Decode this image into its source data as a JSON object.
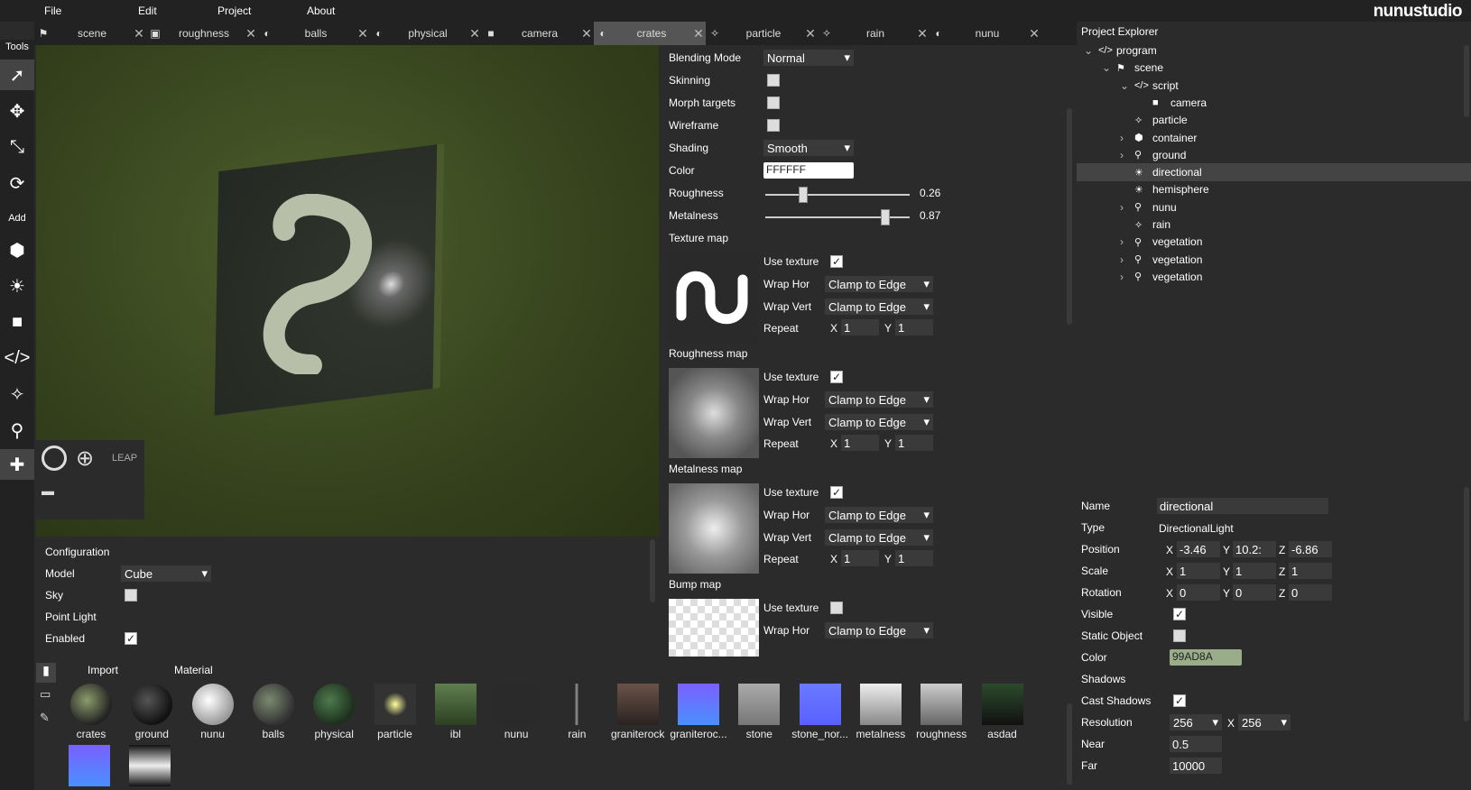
{
  "menu": {
    "file": "File",
    "edit": "Edit",
    "project": "Project",
    "about": "About"
  },
  "logo": "nunustudio",
  "tabs": [
    {
      "label": "scene",
      "icon": "scene-icon"
    },
    {
      "label": "roughness",
      "icon": "image-icon"
    },
    {
      "label": "balls",
      "icon": "material-icon"
    },
    {
      "label": "physical",
      "icon": "material-icon"
    },
    {
      "label": "camera",
      "icon": "camera-icon"
    },
    {
      "label": "crates",
      "icon": "material-icon",
      "active": true
    },
    {
      "label": "particle",
      "icon": "particle-icon"
    },
    {
      "label": "rain",
      "icon": "particle-icon"
    },
    {
      "label": "nunu",
      "icon": "material-icon"
    }
  ],
  "tools": {
    "header": "Tools",
    "add": "Add"
  },
  "leap": "LEAP",
  "config": {
    "title": "Configuration",
    "model_label": "Model",
    "model_value": "Cube",
    "sky_label": "Sky",
    "pointlight_label": "Point Light",
    "enabled_label": "Enabled"
  },
  "material": {
    "blending_label": "Blending Mode",
    "blending_value": "Normal",
    "skinning_label": "Skinning",
    "morph_label": "Morph targets",
    "wireframe_label": "Wireframe",
    "shading_label": "Shading",
    "shading_value": "Smooth",
    "color_label": "Color",
    "color_value": "FFFFFF",
    "roughness_label": "Roughness",
    "roughness_value": "0.26",
    "metalness_label": "Metalness",
    "metalness_value": "0.87",
    "texture_map_label": "Texture map",
    "roughness_map_label": "Roughness map",
    "metalness_map_label": "Metalness map",
    "bump_map_label": "Bump map",
    "use_texture": "Use texture",
    "wrap_hor": "Wrap Hor",
    "wrap_vert": "Wrap Vert",
    "repeat": "Repeat",
    "clamp": "Clamp to Edge",
    "x": "X",
    "y": "Y",
    "one": "1"
  },
  "assets": {
    "import": "Import",
    "material": "Material",
    "items": [
      {
        "name": "crates"
      },
      {
        "name": "ground"
      },
      {
        "name": "nunu"
      },
      {
        "name": "balls"
      },
      {
        "name": "physical"
      },
      {
        "name": "particle"
      },
      {
        "name": "ibl"
      },
      {
        "name": "nunu"
      },
      {
        "name": "rain"
      },
      {
        "name": "graniterock"
      },
      {
        "name": "graniteroc..."
      },
      {
        "name": "stone"
      },
      {
        "name": "stone_nor..."
      },
      {
        "name": "metalness"
      },
      {
        "name": "roughness"
      },
      {
        "name": "asdad"
      }
    ]
  },
  "explorer": {
    "title": "Project Explorer",
    "nodes": [
      {
        "label": "program"
      },
      {
        "label": "scene"
      },
      {
        "label": "script"
      },
      {
        "label": "camera"
      },
      {
        "label": "particle"
      },
      {
        "label": "container"
      },
      {
        "label": "ground"
      },
      {
        "label": "directional"
      },
      {
        "label": "hemisphere"
      },
      {
        "label": "nunu"
      },
      {
        "label": "rain"
      },
      {
        "label": "vegetation"
      },
      {
        "label": "vegetation"
      },
      {
        "label": "vegetation"
      }
    ]
  },
  "inspector": {
    "name_label": "Name",
    "name_value": "directional",
    "type_label": "Type",
    "type_value": "DirectionalLight",
    "position_label": "Position",
    "pos_x": "-3.46",
    "pos_y": "10.2:",
    "pos_z": "-6.86",
    "scale_label": "Scale",
    "scale_x": "1",
    "scale_y": "1",
    "scale_z": "1",
    "rotation_label": "Rotation",
    "rot_x": "0",
    "rot_y": "0",
    "rot_z": "0",
    "visible_label": "Visible",
    "static_label": "Static Object",
    "color_label": "Color",
    "color_value": "99AD8A",
    "shadows_label": "Shadows",
    "cast_label": "Cast Shadows",
    "resolution_label": "Resolution",
    "res_w": "256",
    "res_h": "256",
    "res_x": "X",
    "near_label": "Near",
    "near_value": "0.5",
    "far_label": "Far",
    "far_value": "10000",
    "x": "X",
    "y": "Y",
    "z": "Z"
  },
  "colors": {
    "accent_color": "#99AD8A"
  }
}
